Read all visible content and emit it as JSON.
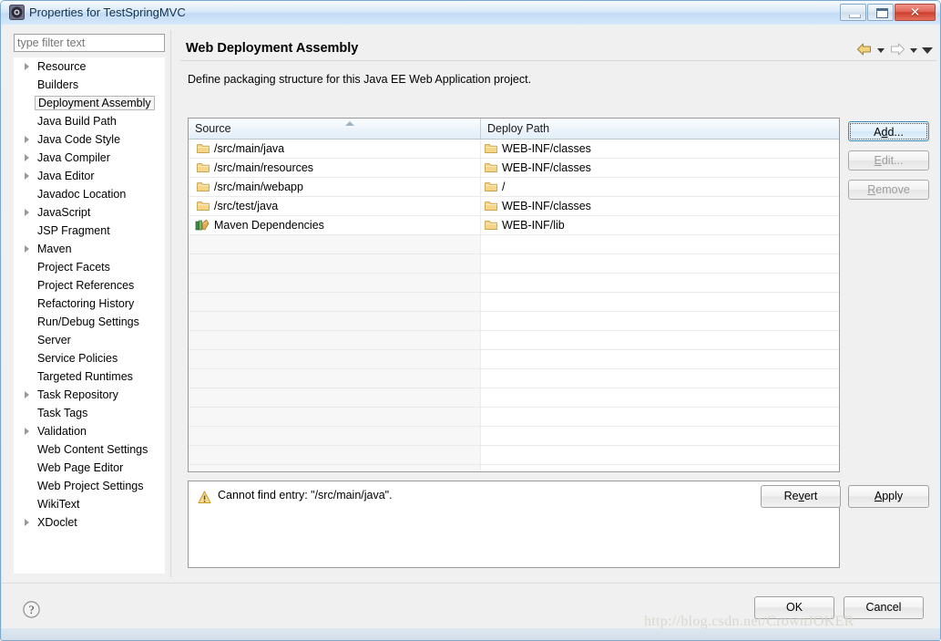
{
  "window": {
    "title": "Properties for TestSpringMVC",
    "icon": "gear-icon",
    "minimize_label": "",
    "maximize_label": "",
    "close_label": "✕"
  },
  "filter": {
    "placeholder": "type filter text",
    "value": ""
  },
  "tree": {
    "selected": "Deployment Assembly",
    "items": [
      {
        "label": "Resource",
        "expandable": true
      },
      {
        "label": "Builders",
        "expandable": false
      },
      {
        "label": "Deployment Assembly",
        "expandable": false,
        "selected": true
      },
      {
        "label": "Java Build Path",
        "expandable": false
      },
      {
        "label": "Java Code Style",
        "expandable": true
      },
      {
        "label": "Java Compiler",
        "expandable": true
      },
      {
        "label": "Java Editor",
        "expandable": true
      },
      {
        "label": "Javadoc Location",
        "expandable": false
      },
      {
        "label": "JavaScript",
        "expandable": true
      },
      {
        "label": "JSP Fragment",
        "expandable": false
      },
      {
        "label": "Maven",
        "expandable": true
      },
      {
        "label": "Project Facets",
        "expandable": false
      },
      {
        "label": "Project References",
        "expandable": false
      },
      {
        "label": "Refactoring History",
        "expandable": false
      },
      {
        "label": "Run/Debug Settings",
        "expandable": false
      },
      {
        "label": "Server",
        "expandable": false
      },
      {
        "label": "Service Policies",
        "expandable": false
      },
      {
        "label": "Targeted Runtimes",
        "expandable": false
      },
      {
        "label": "Task Repository",
        "expandable": true
      },
      {
        "label": "Task Tags",
        "expandable": false
      },
      {
        "label": "Validation",
        "expandable": true
      },
      {
        "label": "Web Content Settings",
        "expandable": false
      },
      {
        "label": "Web Page Editor",
        "expandable": false
      },
      {
        "label": "Web Project Settings",
        "expandable": false
      },
      {
        "label": "WikiText",
        "expandable": false
      },
      {
        "label": "XDoclet",
        "expandable": true
      }
    ]
  },
  "page": {
    "title": "Web Deployment Assembly",
    "description": "Define packaging structure for this Java EE Web Application project."
  },
  "nav": {
    "back_icon": "back-arrow-icon",
    "back_enabled": true,
    "forward_icon": "forward-arrow-icon",
    "forward_enabled": false,
    "menu_icon": "chevron-down-icon"
  },
  "table": {
    "columns": [
      "Source",
      "Deploy Path"
    ],
    "sort_column": "Source",
    "sort_direction": "ascending",
    "rows": [
      {
        "source": "/src/main/java",
        "source_icon": "folder-icon",
        "deploy": "WEB-INF/classes",
        "deploy_icon": "folder-icon"
      },
      {
        "source": "/src/main/resources",
        "source_icon": "folder-icon",
        "deploy": "WEB-INF/classes",
        "deploy_icon": "folder-icon"
      },
      {
        "source": "/src/main/webapp",
        "source_icon": "folder-icon",
        "deploy": "/",
        "deploy_icon": "folder-icon"
      },
      {
        "source": "/src/test/java",
        "source_icon": "folder-icon",
        "deploy": "WEB-INF/classes",
        "deploy_icon": "folder-icon"
      },
      {
        "source": "Maven Dependencies",
        "source_icon": "library-icon",
        "deploy": "WEB-INF/lib",
        "deploy_icon": "folder-icon"
      }
    ],
    "empty_row_count": 13
  },
  "side_buttons": {
    "add": {
      "label": "Add...",
      "mnemonic": "d",
      "enabled": true,
      "focused": true
    },
    "edit": {
      "label": "Edit...",
      "mnemonic": "E",
      "enabled": false,
      "focused": false
    },
    "remove": {
      "label": "Remove",
      "mnemonic": "R",
      "enabled": false,
      "focused": false
    }
  },
  "message": {
    "icon": "warning-icon",
    "text": "Cannot find entry: \"/src/main/java\"."
  },
  "apply_buttons": {
    "revert": {
      "label": "Revert",
      "mnemonic": "v"
    },
    "apply": {
      "label": "Apply",
      "mnemonic": "A"
    }
  },
  "dialog_buttons": {
    "help": {
      "icon": "help-icon"
    },
    "ok": {
      "label": "OK"
    },
    "cancel": {
      "label": "Cancel"
    }
  },
  "watermark": {
    "text": "http://blog.csdn.net/CrownJOKER"
  },
  "colors": {
    "title_bar": "#cfe3f7",
    "close_button": "#cd3d2c",
    "focus_border": "#3c8dbc",
    "folder_icon": "#f6d488",
    "warning_icon": "#e8a317",
    "disabled_text": "#9d9d9d",
    "sort_arrow": "#9db3c6"
  }
}
